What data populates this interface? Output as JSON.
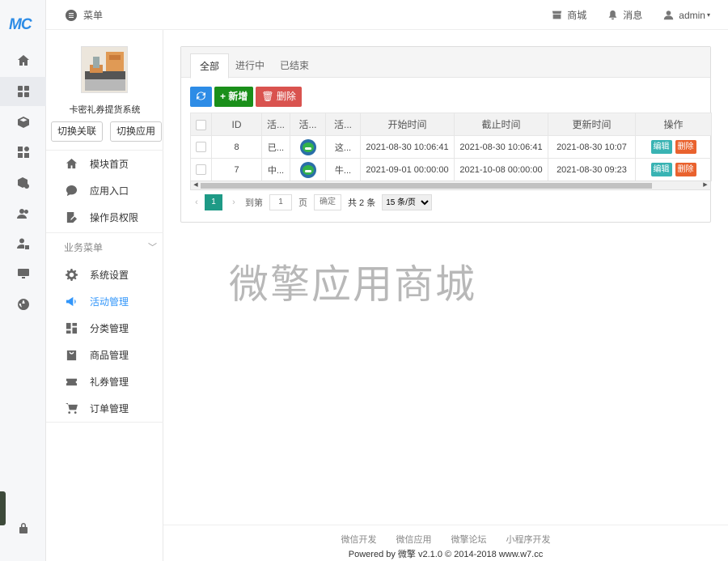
{
  "rail": {
    "logo": "MC",
    "icons": [
      "home-icon",
      "apps-icon",
      "cube-icon",
      "widgets-icon",
      "box-gear-icon",
      "users-icon",
      "user-lock-icon",
      "monitor-icon",
      "globe-icon",
      "lock-icon"
    ]
  },
  "topbar": {
    "menu_label": "菜单",
    "store_label": "商城",
    "messages_label": "消息",
    "user_label": "admin"
  },
  "sidebar": {
    "app_name": "卡密礼券提货系统",
    "switch_link_label": "切换关联",
    "switch_app_label": "切换应用",
    "top_items": [
      {
        "label": "模块首页",
        "icon": "home-icon"
      },
      {
        "label": "应用入口",
        "icon": "chat-icon"
      },
      {
        "label": "操作员权限",
        "icon": "edit-doc-icon"
      }
    ],
    "group_title": "业务菜单",
    "items": [
      {
        "label": "系统设置",
        "icon": "gear-icon"
      },
      {
        "label": "活动管理",
        "icon": "megaphone-icon"
      },
      {
        "label": "分类管理",
        "icon": "dashboard-icon"
      },
      {
        "label": "商品管理",
        "icon": "bag-icon"
      },
      {
        "label": "礼券管理",
        "icon": "ticket-icon"
      },
      {
        "label": "订单管理",
        "icon": "cart-icon"
      }
    ]
  },
  "tabs": [
    "全部",
    "进行中",
    "已结束"
  ],
  "toolbar": {
    "add_label": "+ 新增",
    "delete_label": "删除"
  },
  "table": {
    "headers": [
      "ID",
      "活...",
      "活...",
      "活...",
      "开始时间",
      "截止时间",
      "更新时间",
      "操作"
    ],
    "rows": [
      {
        "id": "8",
        "c1": "已...",
        "c3": "这...",
        "start": "2021-08-30 10:06:41",
        "end": "2021-08-30 10:06:41",
        "updated": "2021-08-30 10:07"
      },
      {
        "id": "7",
        "c1": "中...",
        "c3": "牛...",
        "start": "2021-09-01 00:00:00",
        "end": "2021-10-08 00:00:00",
        "updated": "2021-08-30 09:23"
      }
    ],
    "edit_label": "编辑",
    "delete_label": "删除"
  },
  "pager": {
    "current_page": "1",
    "goto_prefix": "到第",
    "goto_value": "1",
    "goto_suffix": "页",
    "confirm_label": "确定",
    "total_label": "共 2 条",
    "per_page": "15 条/页"
  },
  "watermark": "微擎应用商城",
  "footer": {
    "links": [
      "微信开发",
      "微信应用",
      "微擎论坛",
      "小程序开发"
    ],
    "copyright": "Powered by 微擎 v2.1.0 © 2014-2018 www.w7.cc"
  }
}
